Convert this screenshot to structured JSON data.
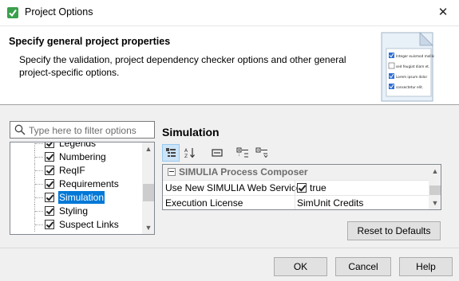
{
  "window": {
    "title": "Project Options",
    "close_glyph": "✕"
  },
  "banner": {
    "heading": "Specify general project properties",
    "description": "Specify the validation, project dependency checker options and other general project-specific options.",
    "illustration_items": [
      "Integer euismod mollis",
      "sed feugiat diam et.",
      "Lorem ipsum dolor",
      "consectetur elit."
    ]
  },
  "filter": {
    "placeholder": "Type here to filter options",
    "value": ""
  },
  "tree": {
    "items": [
      {
        "label": "Legends",
        "checked": true
      },
      {
        "label": "Numbering",
        "checked": true
      },
      {
        "label": "ReqIF",
        "checked": true
      },
      {
        "label": "Requirements",
        "checked": true
      },
      {
        "label": "Simulation",
        "checked": true,
        "selected": true
      },
      {
        "label": "Styling",
        "checked": true
      },
      {
        "label": "Suspect Links",
        "checked": true
      }
    ]
  },
  "section": {
    "title": "Simulation"
  },
  "toolbar": {
    "buttons": [
      "categorized-view-icon",
      "alphabetical-sort-icon",
      "property-pages-icon",
      "expand-all-icon",
      "collapse-all-icon"
    ]
  },
  "properties": {
    "group": "SIMULIA Process Composer",
    "rows": [
      {
        "name": "Use New SIMULIA Web Service",
        "value": "true",
        "checkbox": true
      },
      {
        "name": "Execution License",
        "value": "SimUnit Credits",
        "checkbox": false
      }
    ]
  },
  "buttons": {
    "reset": "Reset to Defaults",
    "ok": "OK",
    "cancel": "Cancel",
    "help": "Help"
  },
  "colors": {
    "selection": "#0078d7",
    "window_bg": "#f0f0f0",
    "accent_icon": "#2f6fd6"
  }
}
